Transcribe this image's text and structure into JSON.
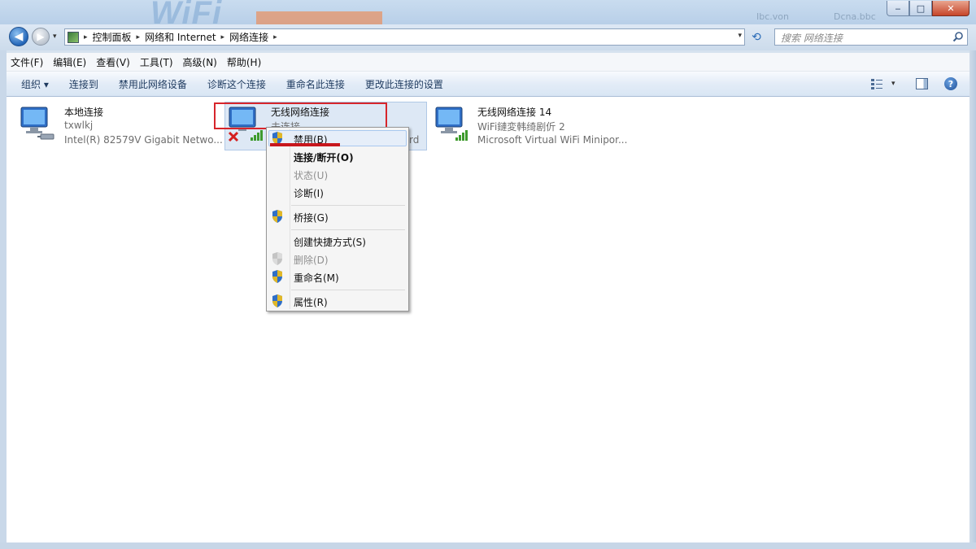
{
  "window": {
    "watermark_logo": "WiFi",
    "watermark_text_a": "Ibc.von",
    "watermark_text_b": "Dcna.bbc",
    "min_glyph": "‒",
    "max_glyph": "□",
    "close_glyph": "✕"
  },
  "nav": {
    "back_glyph": "◀",
    "forward_glyph": "▶",
    "recent_glyph": "▾",
    "breadcrumbs": [
      "控制面板",
      "网络和 Internet",
      "网络连接"
    ],
    "crumb_sep": "▸",
    "refresh_glyph": "⟲",
    "dropdown_glyph": "▾",
    "search_placeholder": "搜索 网络连接"
  },
  "menu": [
    "文件(F)",
    "编辑(E)",
    "查看(V)",
    "工具(T)",
    "高级(N)",
    "帮助(H)"
  ],
  "toolbar": {
    "organize": "组织 ▾",
    "connect_to": "连接到",
    "disable_device": "禁用此网络设备",
    "diagnose": "诊断这个连接",
    "rename": "重命名此连接",
    "change_settings": "更改此连接的设置",
    "view_drop": "▾",
    "help": "?"
  },
  "connections": [
    {
      "name": "本地连接",
      "status": "txwlkj",
      "device": "Intel(R) 82579V Gigabit Netwo..."
    },
    {
      "name": "无线网络连接",
      "status": "未连接",
      "device": "rd"
    },
    {
      "name": "无线网络连接 14",
      "status": "WiFi鏈変韩绮剧伒  2",
      "device": "Microsoft Virtual WiFi Minipor..."
    }
  ],
  "context_menu": {
    "items": [
      {
        "label": "禁用(B)",
        "state": "hover"
      },
      {
        "label": "连接/断开(O)",
        "state": "bold"
      },
      {
        "label": "状态(U)",
        "state": "disabled"
      },
      {
        "label": "诊断(I)",
        "state": "normal"
      },
      {
        "label": "桥接(G)",
        "state": "normal"
      },
      {
        "label": "创建快捷方式(S)",
        "state": "normal"
      },
      {
        "label": "删除(D)",
        "state": "disabled"
      },
      {
        "label": "重命名(M)",
        "state": "normal"
      },
      {
        "label": "属性(R)",
        "state": "normal"
      }
    ]
  },
  "colors": {
    "highlight_red": "#d7252b",
    "selection_bg": "#dde8f5",
    "signal_green": "#3e9b2d"
  }
}
